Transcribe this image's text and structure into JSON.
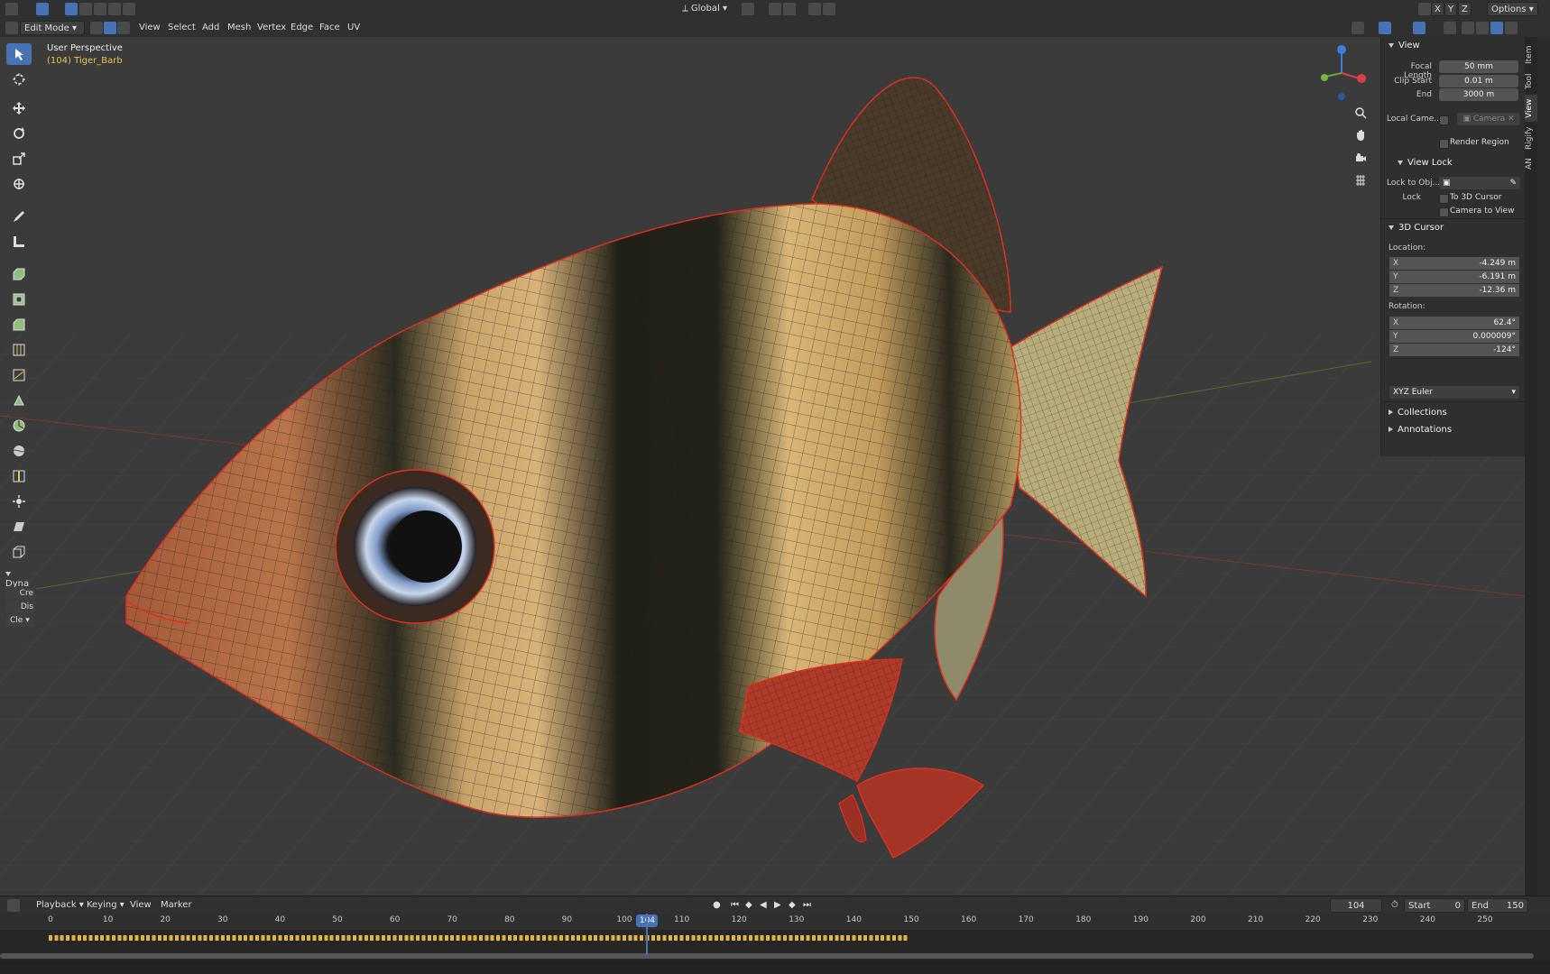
{
  "header": {
    "transform_orientation": "Global",
    "options_label": "Options",
    "axis_x": "X",
    "axis_y": "Y",
    "axis_z": "Z"
  },
  "viewport_header": {
    "mode": "Edit Mode",
    "menus": [
      "View",
      "Select",
      "Add",
      "Mesh",
      "Vertex",
      "Edge",
      "Face",
      "UV"
    ]
  },
  "viewport": {
    "perspective": "User Perspective",
    "object_info": "(104) Tiger_Barb"
  },
  "toolbar": {
    "tools": [
      "select-box-icon",
      "cursor-icon",
      "move-icon",
      "rotate-icon",
      "scale-icon",
      "transform-icon",
      "annotate-icon",
      "measure-icon",
      "extrude-icon",
      "inset-icon",
      "bevel-icon",
      "loop-cut-icon",
      "knife-icon",
      "poly-build-icon",
      "spin-icon",
      "smooth-icon",
      "edge-slide-icon",
      "shrink-fatten-icon",
      "shear-icon",
      "rip-icon"
    ],
    "dyna_label": "Dyna",
    "dyna_buttons": [
      "Cre",
      "Dis",
      "Cle"
    ]
  },
  "npanel": {
    "tabs": [
      "Item",
      "Tool",
      "View",
      "Rigify",
      "AN"
    ],
    "view": {
      "title": "View",
      "focal_length_label": "Focal Length",
      "focal_length": "50 mm",
      "clip_start_label": "Clip Start",
      "clip_start": "0.01 m",
      "end_label": "End",
      "end": "3000 m",
      "local_camera_label": "Local Came...",
      "camera_placeholder": "Camera",
      "render_region_label": "Render Region"
    },
    "view_lock": {
      "title": "View Lock",
      "lock_to_obj_label": "Lock to Obj...",
      "lock_label": "Lock",
      "to_3d_cursor_label": "To 3D Cursor",
      "camera_to_view_label": "Camera to View"
    },
    "cursor": {
      "title": "3D Cursor",
      "location_label": "Location:",
      "location": [
        {
          "axis": "X",
          "value": "-4.249 m"
        },
        {
          "axis": "Y",
          "value": "-6.191 m"
        },
        {
          "axis": "Z",
          "value": "-12.36 m"
        }
      ],
      "rotation_label": "Rotation:",
      "rotation": [
        {
          "axis": "X",
          "value": "62.4°"
        },
        {
          "axis": "Y",
          "value": "0.000009°"
        },
        {
          "axis": "Z",
          "value": "-124°"
        }
      ],
      "rotation_mode": "XYZ Euler"
    },
    "collections_label": "Collections",
    "annotations_label": "Annotations"
  },
  "timeline": {
    "menus": [
      "Playback",
      "Keying",
      "View",
      "Marker"
    ],
    "current_frame": "104",
    "start_label": "Start",
    "start": "0",
    "end_label": "End",
    "end": "150",
    "ticks": [
      "0",
      "10",
      "20",
      "30",
      "40",
      "50",
      "60",
      "70",
      "80",
      "90",
      "100",
      "110",
      "120",
      "130",
      "140",
      "150",
      "160",
      "170",
      "180",
      "190",
      "200",
      "210",
      "220",
      "230",
      "240",
      "250"
    ]
  },
  "colors": {
    "accent": "#4772b3",
    "selection_outline": "#e0301e",
    "keyframe": "#e6b43c"
  }
}
